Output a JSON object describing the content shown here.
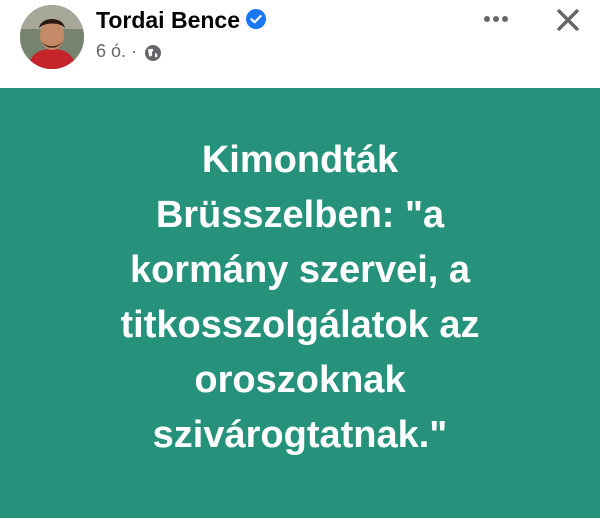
{
  "post": {
    "author": "Tordai Bence",
    "time": "6 ó. ·",
    "text_lines": [
      "Kimondták",
      "Brüsszelben: \"a",
      "kormány szervei, a",
      "titkosszolgálatok az",
      "oroszoknak",
      "szivárogtatnak.\""
    ]
  },
  "icons": {
    "verified": "verified-badge-icon",
    "audience": "globe-icon",
    "more": "more-options-icon",
    "close": "close-icon"
  },
  "colors": {
    "card_background": "#27927c",
    "text": "#ffffff",
    "verified": "#1877f2"
  }
}
